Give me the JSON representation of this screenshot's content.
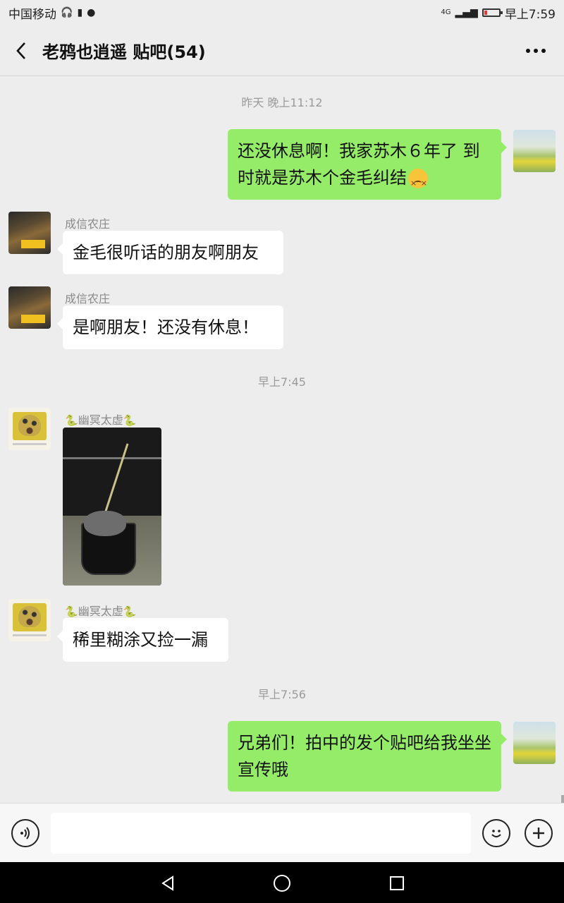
{
  "status": {
    "carrier": "中国移动",
    "network": "4G",
    "time": "早上7:59"
  },
  "header": {
    "title": "老鸦也逍遥  贴吧(54)"
  },
  "messages": {
    "t1": "昨天 晚上11:12",
    "m1_text": "还没休息啊！我家苏木６年了 到时就是苏木个金毛纠结",
    "m2_sender": "成信农庄",
    "m2_text": "金毛很听话的朋友啊朋友",
    "m3_sender": "成信农庄",
    "m3_text": "是啊朋友！还没有休息！",
    "t2": "早上7:45",
    "m4_sender_name": "幽冥太虚",
    "m5_sender_name": "幽冥太虚",
    "m5_text": "稀里糊涂又捡一漏",
    "t3": "早上7:56",
    "m6_text": "兄弟们！拍中的发个贴吧给我坐坐宣传哦"
  },
  "input": {
    "value": ""
  },
  "icons": {
    "back": "chevron-left-icon",
    "more": "more-dots-icon",
    "voice": "voice-icon",
    "emoji": "emoji-icon",
    "plus": "plus-icon",
    "snake": "snake-emoji-icon",
    "persevere": "persevering-face-emoji-icon"
  },
  "colors": {
    "out_bubble": "#95ec69",
    "in_bubble": "#ffffff",
    "background": "#ededed"
  }
}
